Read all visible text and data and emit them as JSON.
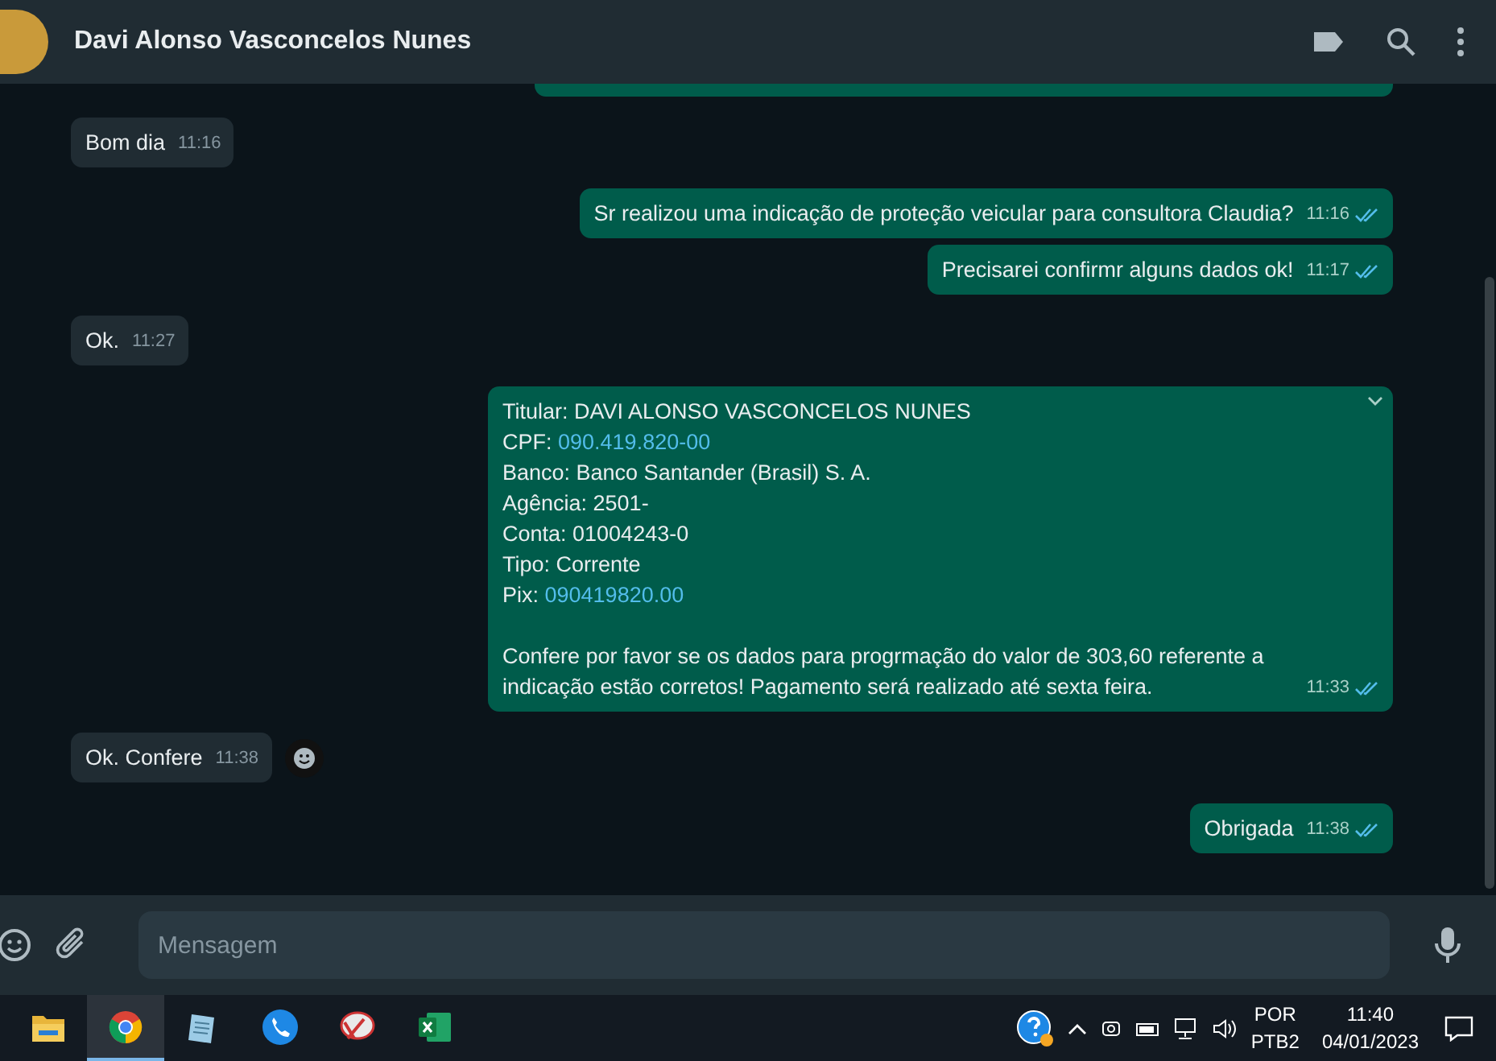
{
  "header": {
    "contact_name": "Davi Alonso Vasconcelos Nunes"
  },
  "messages": [
    {
      "sent": false,
      "kind": "text",
      "text": "Bom dia",
      "time": "11:16"
    },
    {
      "sent": true,
      "kind": "text",
      "text": "Sr realizou uma indicação de proteção veicular para consultora Claudia?",
      "time": "11:16",
      "read": true
    },
    {
      "sent": true,
      "kind": "text",
      "text": "Precisarei confirmr alguns dados ok!",
      "time": "11:17",
      "read": true
    },
    {
      "sent": false,
      "kind": "text",
      "text": "Ok.",
      "time": "11:27"
    },
    {
      "sent": true,
      "kind": "details",
      "fields": [
        {
          "label": "Titular: DAVI ALONSO VASCONCELOS NUNES"
        },
        {
          "label": "CPF: ",
          "link": "090.419.820-00"
        },
        {
          "label": "Banco: Banco Santander (Brasil) S. A."
        },
        {
          "label": "Agência: 2501-"
        },
        {
          "label": "Conta: 01004243-0"
        },
        {
          "label": "Tipo: Corrente"
        },
        {
          "label": "Pix: ",
          "link": "090419820.00"
        }
      ],
      "text": "Confere por favor se os dados para progrmação do valor de 303,60 referente a indicação estão corretos! Pagamento será realizado até sexta feira.",
      "time": "11:33",
      "read": true
    },
    {
      "sent": false,
      "kind": "text",
      "text": "Ok. Confere",
      "time": "11:38",
      "reaction_button": true
    },
    {
      "sent": true,
      "kind": "text",
      "text": "Obrigada",
      "time": "11:38",
      "read": true
    }
  ],
  "composer": {
    "placeholder": "Mensagem"
  },
  "taskbar": {
    "apps": [
      {
        "kind": "folder",
        "selected": false
      },
      {
        "kind": "browser",
        "selected": true
      },
      {
        "kind": "notepad",
        "selected": false
      },
      {
        "kind": "phone",
        "selected": false
      },
      {
        "kind": "snip",
        "selected": false
      },
      {
        "kind": "excel",
        "selected": false
      }
    ],
    "language": "POR",
    "layout": "PTB2",
    "time": "11:40",
    "date": "04/01/2023"
  }
}
